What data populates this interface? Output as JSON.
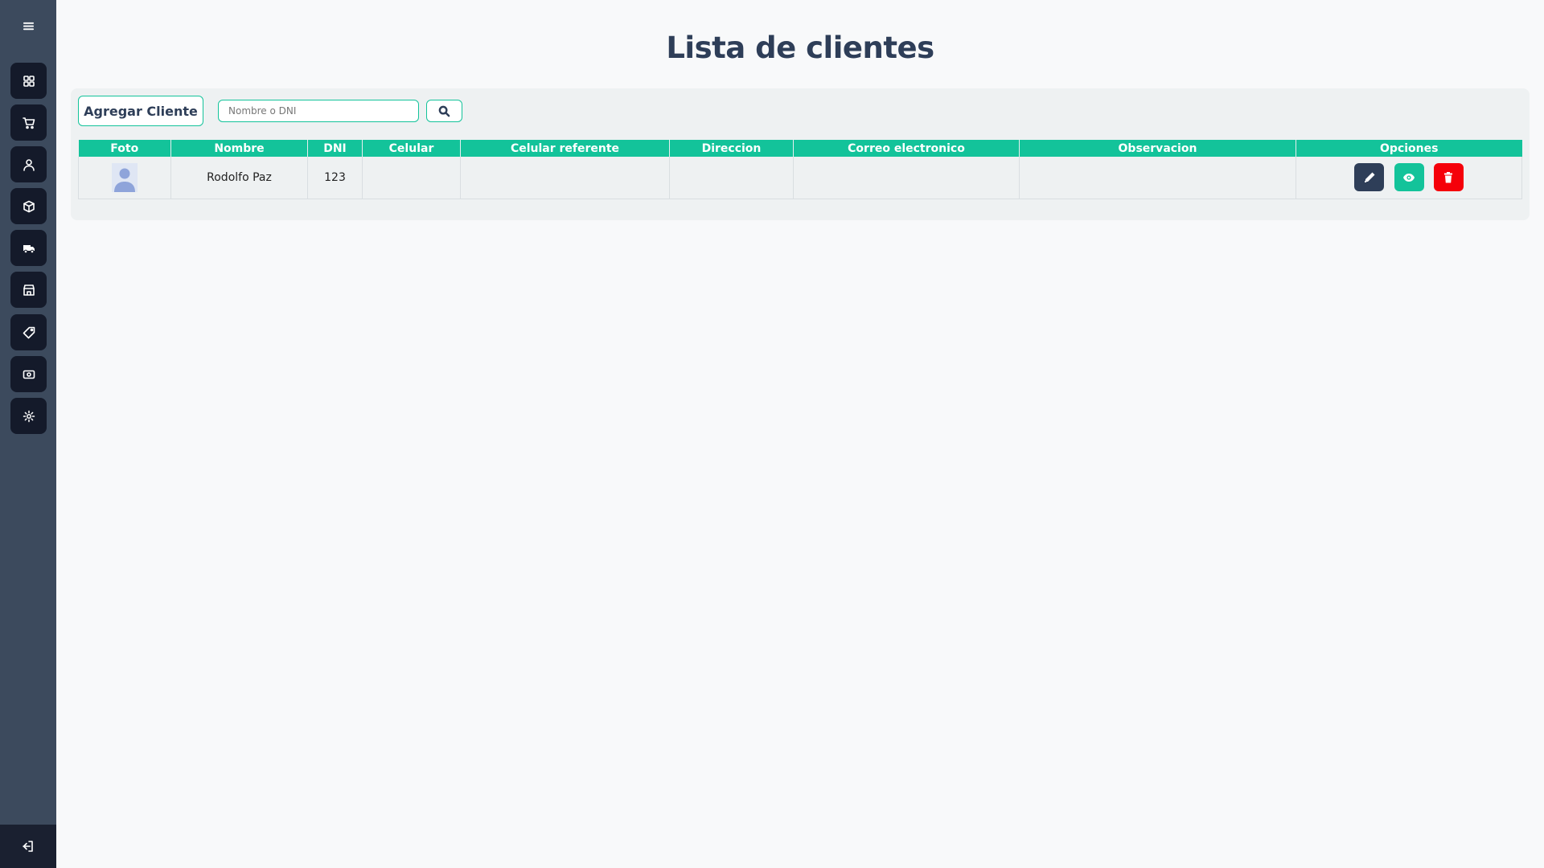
{
  "page": {
    "title": "Lista de clientes"
  },
  "sidebar": {
    "menu_icon": "hamburger-icon",
    "items": [
      {
        "name": "dashboard",
        "icon": "grid-icon"
      },
      {
        "name": "sales",
        "icon": "cart-icon"
      },
      {
        "name": "clients",
        "icon": "user-icon"
      },
      {
        "name": "products",
        "icon": "box-icon"
      },
      {
        "name": "delivery",
        "icon": "truck-icon"
      },
      {
        "name": "store",
        "icon": "store-icon"
      },
      {
        "name": "tags",
        "icon": "tag-icon"
      },
      {
        "name": "cash",
        "icon": "money-icon"
      },
      {
        "name": "settings",
        "icon": "gear-icon"
      }
    ],
    "logout_icon": "logout-icon"
  },
  "toolbar": {
    "add_label": "Agregar Cliente",
    "search_placeholder": "Nombre o DNI",
    "search_value": "",
    "search_icon": "search-icon"
  },
  "table": {
    "columns": [
      "Foto",
      "Nombre",
      "DNI",
      "Celular",
      "Celular referente",
      "Direccion",
      "Correo electronico",
      "Observacion",
      "Opciones"
    ],
    "rows": [
      {
        "foto": "avatar-placeholder",
        "nombre": "Rodolfo Paz",
        "dni": "123",
        "celular": "",
        "celular_referente": "",
        "direccion": "",
        "correo": "",
        "observacion": ""
      }
    ]
  },
  "colors": {
    "sidebar_bg": "#3c4a5d",
    "nav_btn_bg": "#141a2a",
    "accent": "#13c39a",
    "title": "#2e3e58",
    "edit": "#2e3e58",
    "view": "#13c39a",
    "delete": "#f5000a"
  }
}
